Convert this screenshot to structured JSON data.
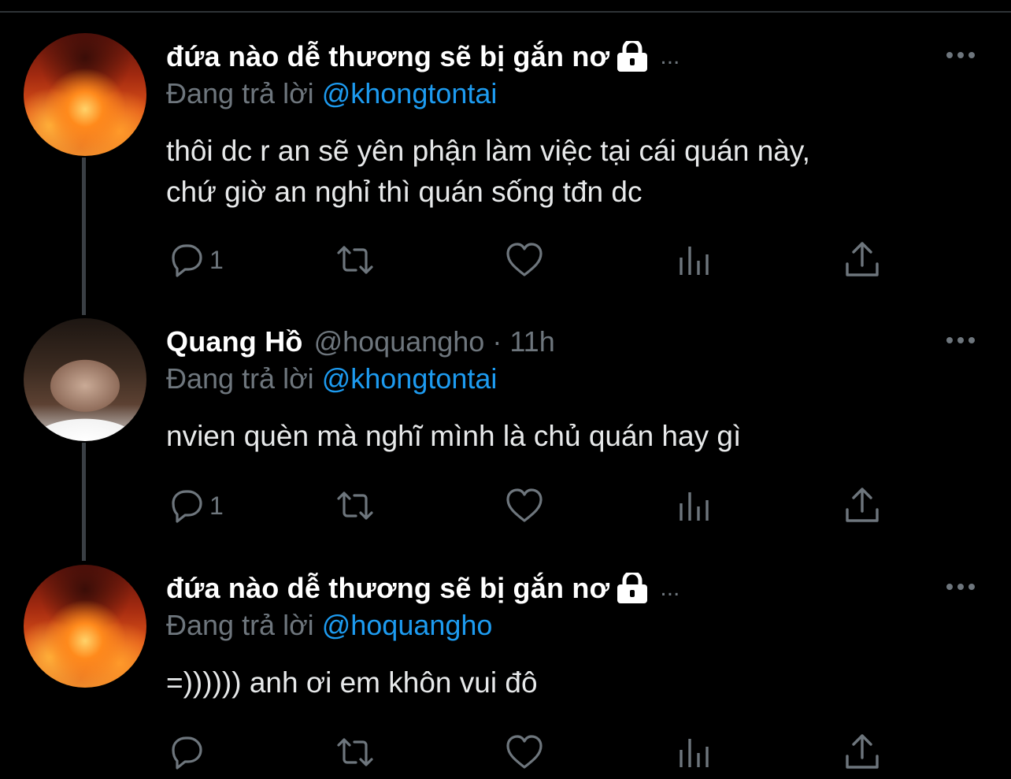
{
  "tweets": [
    {
      "display_name": "đứa nào dễ thương sẽ bị gắn nơ",
      "protected": true,
      "handle_time": "",
      "ellipsis": "...",
      "reply_label": "Đang trả lời",
      "reply_handle": "@khongtontai",
      "text_lines": [
        "thôi dc r an sẽ yên phận làm việc tại cái quán này,",
        "chứ giờ an nghỉ thì quán sống tđn dc"
      ],
      "reply_count": "1",
      "avatar": "fire-skeleton-avatar"
    },
    {
      "display_name": "Quang Hồ",
      "protected": false,
      "handle_time": "@hoquangho · 11h",
      "ellipsis": "",
      "reply_label": "Đang trả lời",
      "reply_handle": "@khongtontai",
      "text_lines": [
        "nvien quèn mà nghĩ mình là chủ quán hay gì"
      ],
      "reply_count": "1",
      "avatar": "person-avatar"
    },
    {
      "display_name": "đứa nào dễ thương sẽ bị gắn nơ",
      "protected": true,
      "handle_time": "",
      "ellipsis": "...",
      "reply_label": "Đang trả lời",
      "reply_handle": "@hoquangho",
      "text_lines": [
        "=)))))) anh ơi em khôn vui đô"
      ],
      "reply_count": "",
      "avatar": "fire-skeleton-avatar"
    }
  ],
  "icons": {
    "reply": "reply-icon",
    "retweet": "retweet-icon",
    "like": "heart-icon",
    "views": "views-icon",
    "share": "share-icon",
    "more": "more-icon",
    "lock": "lock-icon"
  },
  "colors": {
    "background": "#000000",
    "text": "#e7e9ea",
    "secondary": "#6e767d",
    "link": "#1d9bf0",
    "thread_line": "#3a3f44"
  }
}
